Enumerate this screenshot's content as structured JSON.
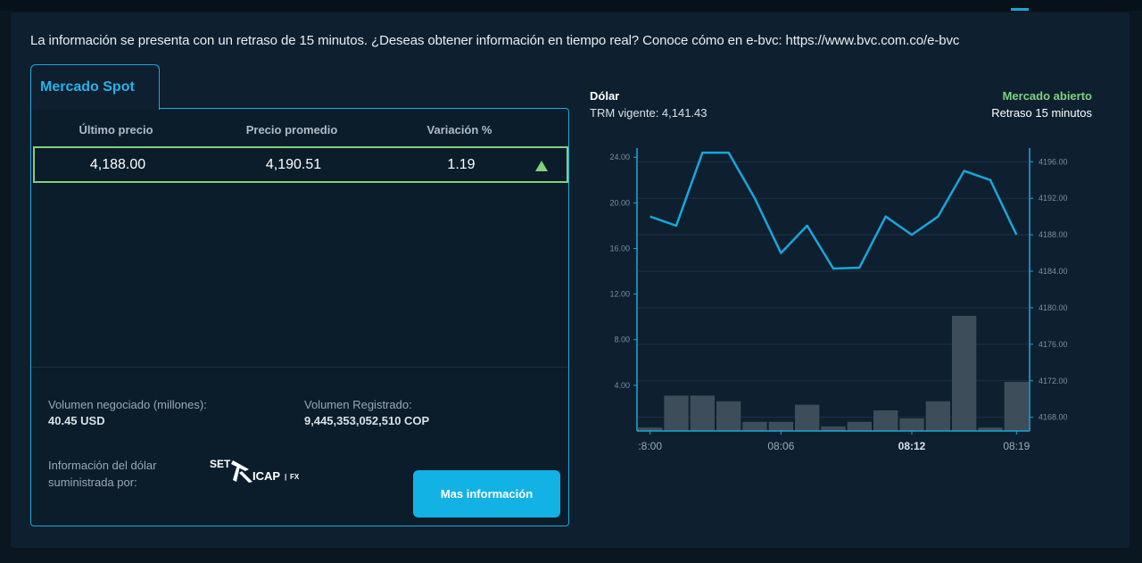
{
  "notice": "La información se presenta con un retraso de 15 minutos. ¿Deseas obtener información en tiempo real? Conoce cómo en e-bvc: https://www.bvc.com.co/e-bvc",
  "tab": {
    "label": "Mercado Spot"
  },
  "table": {
    "headers": [
      "Último precio",
      "Precio promedio",
      "Variación %"
    ],
    "row": {
      "ultimo": "4,188.00",
      "promedio": "4,190.51",
      "variacion": "1.19",
      "trend_icon": "triangle-up-icon"
    }
  },
  "volume": {
    "negociado_label": "Volumen negociado (millones):",
    "negociado_value": "40.45 USD",
    "registrado_label": "Volumen Registrado:",
    "registrado_value": "9,445,353,052,510 COP"
  },
  "provider": {
    "label": "Información del dólar suministrada por:",
    "logo_text": [
      "SET",
      "ICAP",
      "FX"
    ]
  },
  "button": {
    "label": "Mas información"
  },
  "header": {
    "title": "Dólar",
    "trm": "TRM vigente: 4,141.43",
    "market_status": "Mercado abierto",
    "delay": "Retraso 15 minutos"
  },
  "colors": {
    "accent": "#1ea7d8",
    "positive": "#7fd17d",
    "line": "#1aa6d9",
    "bars": "#3d4d5a",
    "button": "#13b2e5"
  },
  "chart_data": {
    "type": "line+bar",
    "x_ticks": [
      ":8:00",
      "08:06",
      "08:12",
      "08:19"
    ],
    "volume_axis": {
      "ticks": [
        "4.00",
        "8.00",
        "12.00",
        "16.00",
        "20.00",
        "24.00"
      ],
      "ylim": [
        0,
        24.8
      ]
    },
    "price_axis": {
      "ticks": [
        "4168.00",
        "4172.00",
        "4176.00",
        "4180.00",
        "4184.00",
        "4188.00",
        "4192.00",
        "4196.00"
      ],
      "ylim": [
        4166.5,
        4197.5
      ]
    },
    "price_series": [
      4190.0,
      4189.0,
      4197.0,
      4197.0,
      4192.0,
      4186.0,
      4189.0,
      4184.3,
      4184.4,
      4190.0,
      4188.0,
      4190.0,
      4195.0,
      4194.0,
      4188.0
    ],
    "volume_bars": [
      0.3,
      3.1,
      3.1,
      2.6,
      0.8,
      0.8,
      2.3,
      0.4,
      0.8,
      1.8,
      1.1,
      2.6,
      10.1,
      0.3,
      4.3
    ]
  }
}
